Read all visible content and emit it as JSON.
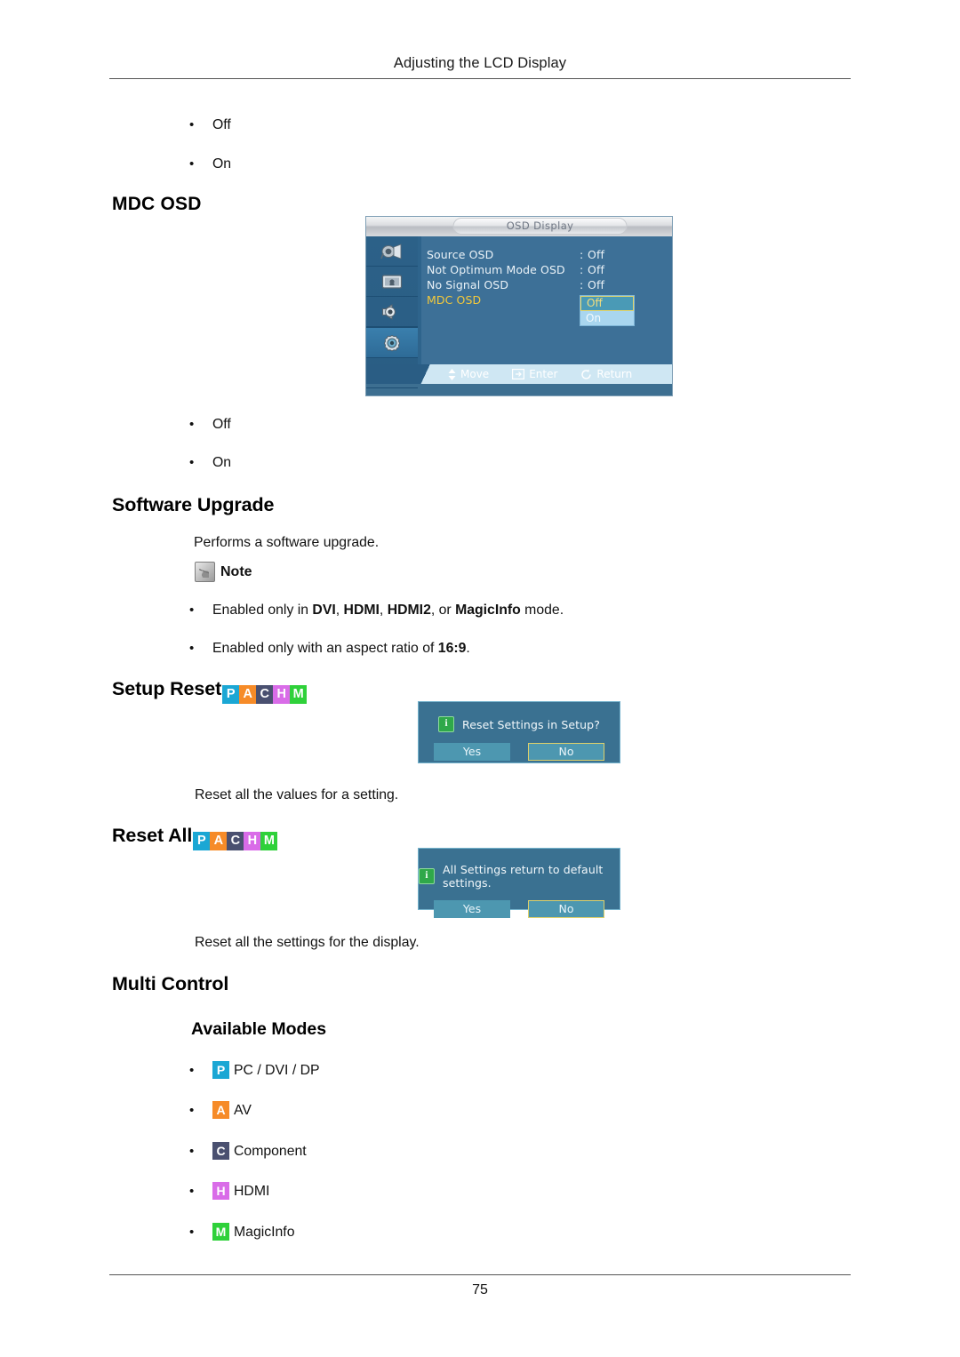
{
  "page": {
    "header_title": "Adjusting the LCD Display",
    "page_number": "75"
  },
  "top_options": {
    "bullet_off": "Off",
    "bullet_on": "On"
  },
  "mdc_osd": {
    "heading": "MDC OSD",
    "bullet_off": "Off",
    "bullet_on": "On",
    "osd_screenshot": {
      "title": "OSD Display",
      "rows": [
        {
          "label": "Source OSD",
          "sep": ":",
          "value": "Off",
          "selected": false
        },
        {
          "label": "Not Optimum Mode OSD",
          "sep": ":",
          "value": "Off",
          "selected": false
        },
        {
          "label": "No Signal OSD",
          "sep": ":",
          "value": "Off",
          "selected": false
        },
        {
          "label": "MDC OSD",
          "sep": ":",
          "value": "",
          "selected": true
        }
      ],
      "dropdown": {
        "selected": "Off",
        "other": "On"
      },
      "sidebar_icons": [
        "input-source-icon",
        "picture-icon",
        "sound-icon",
        "setup-gear-icon",
        "multi-control-icon"
      ],
      "footer": [
        {
          "icon": "updown-arrow-icon",
          "label": "Move"
        },
        {
          "icon": "enter-key-icon",
          "label": "Enter"
        },
        {
          "icon": "return-arrow-icon",
          "label": "Return"
        }
      ]
    }
  },
  "software_upgrade": {
    "heading": "Software Upgrade",
    "description": "Performs a software upgrade.",
    "note_label": "Note",
    "notes": [
      "Enabled only in DVI, HDMI, HDMI2, or MagicInfo mode.",
      "Enabled only with an aspect ratio of 16:9."
    ]
  },
  "setup_reset": {
    "heading": "Setup Reset",
    "badges": [
      "P",
      "A",
      "C",
      "H",
      "M"
    ],
    "dialog": {
      "message": "Reset Settings in Setup?",
      "yes_label": "Yes",
      "no_label": "No",
      "focused_button": "No"
    },
    "description": "Reset all the values for a setting."
  },
  "reset_all": {
    "heading": "Reset All",
    "badges": [
      "P",
      "A",
      "C",
      "H",
      "M"
    ],
    "dialog": {
      "message": "All Settings return to default settings.",
      "yes_label": "Yes",
      "no_label": "No",
      "focused_button": "No"
    },
    "description": "Reset all the settings for the display."
  },
  "multi_control": {
    "heading": "Multi Control",
    "subheading": "Available Modes",
    "modes": [
      {
        "badge": "P",
        "label": "PC / DVI / DP",
        "color": "#1ba7d4"
      },
      {
        "badge": "A",
        "label": "AV",
        "color": "#f68b28"
      },
      {
        "badge": "C",
        "label": "Component",
        "color": "#4a5070"
      },
      {
        "badge": "H",
        "label": "HDMI",
        "color": "#d96ce8"
      },
      {
        "badge": "M",
        "label": "MagicInfo",
        "color": "#2fd13a"
      }
    ]
  },
  "colors": {
    "badge_p": "#1ba7d4",
    "badge_a": "#f68b28",
    "badge_c": "#4a5070",
    "badge_h": "#d96ce8",
    "badge_m": "#2fd13a",
    "osd_body": "#3d7097",
    "osd_footer": "#cfe7f3",
    "dialog_bg": "#3a7191",
    "dialog_focus_border": "#ded06a",
    "osd_selected_label": "#f4c93a"
  }
}
